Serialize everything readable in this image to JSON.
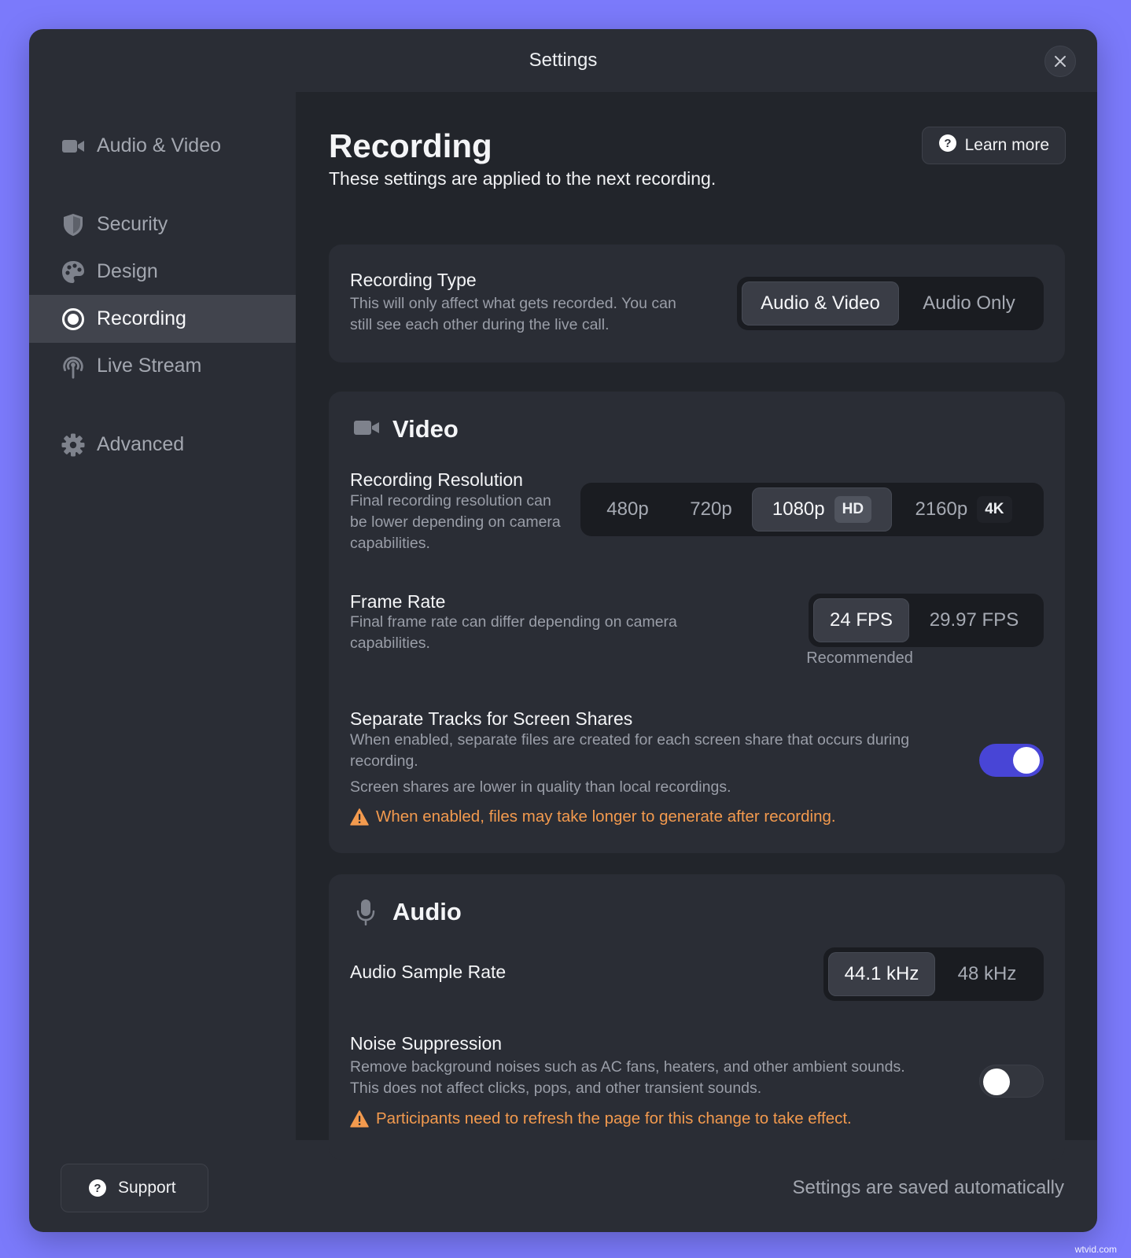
{
  "window": {
    "title": "Settings"
  },
  "sidebar": {
    "items": [
      {
        "label": "Audio & Video",
        "icon": "video-camera-icon",
        "active": false
      },
      {
        "label": "Security",
        "icon": "shield-icon",
        "active": false
      },
      {
        "label": "Design",
        "icon": "palette-icon",
        "active": false
      },
      {
        "label": "Recording",
        "icon": "record-icon",
        "active": true
      },
      {
        "label": "Live Stream",
        "icon": "broadcast-icon",
        "active": false
      },
      {
        "label": "Advanced",
        "icon": "gear-icon",
        "active": false
      }
    ],
    "support_label": "Support"
  },
  "main": {
    "title": "Recording",
    "subtitle": "These settings are applied to the next recording.",
    "learn_more": "Learn more",
    "recording_type": {
      "title": "Recording Type",
      "description": "This will only affect what gets recorded. You can still see each other during the live call.",
      "options": [
        "Audio & Video",
        "Audio Only"
      ],
      "selected": "Audio & Video"
    },
    "video": {
      "heading": "Video",
      "resolution": {
        "title": "Recording Resolution",
        "description": "Final recording resolution can be lower depending on camera capabilities.",
        "options": [
          {
            "label": "480p",
            "badge": ""
          },
          {
            "label": "720p",
            "badge": ""
          },
          {
            "label": "1080p",
            "badge": "HD"
          },
          {
            "label": "2160p",
            "badge": "4K"
          }
        ],
        "selected": "1080p"
      },
      "frame_rate": {
        "title": "Frame Rate",
        "description": "Final frame rate can differ depending on camera capabilities.",
        "options": [
          "24 FPS",
          "29.97 FPS"
        ],
        "selected": "24 FPS",
        "recommended_label": "Recommended"
      },
      "separate_tracks": {
        "title": "Separate Tracks for Screen Shares",
        "description": "When enabled, separate files are created for each screen share that occurs during recording.",
        "note": "Screen shares are lower in quality than local recordings.",
        "warning": "When enabled, files may take longer to generate after recording.",
        "enabled": true
      }
    },
    "audio": {
      "heading": "Audio",
      "sample_rate": {
        "title": "Audio Sample Rate",
        "options": [
          "44.1 kHz",
          "48 kHz"
        ],
        "selected": "44.1 kHz"
      },
      "noise_suppression": {
        "title": "Noise Suppression",
        "description": "Remove background noises such as AC fans, heaters, and other ambient sounds. This does not affect clicks, pops, and other transient sounds.",
        "warning": "Participants need to refresh the page for this change to take effect.",
        "enabled": false
      }
    }
  },
  "footer": {
    "autosave_text": "Settings are saved automatically"
  },
  "watermark": "wtvid.com",
  "colors": {
    "background": "#7b7afb",
    "accent": "#4845d6",
    "warning": "#f39a4e",
    "panel": "#2a2d35"
  }
}
